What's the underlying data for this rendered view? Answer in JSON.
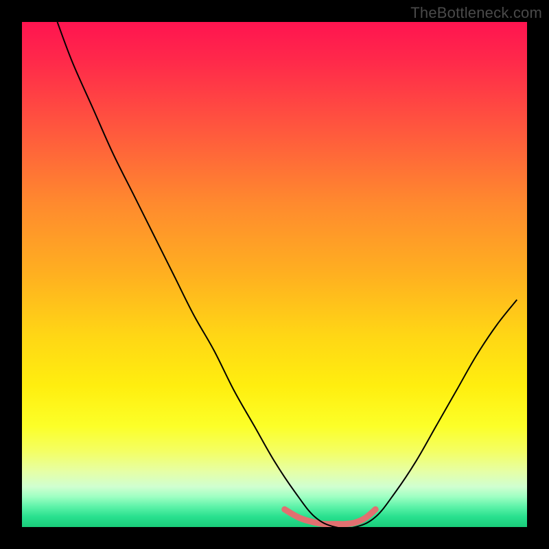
{
  "watermark": "TheBottleneck.com",
  "chart_data": {
    "type": "line",
    "title": "",
    "xlabel": "",
    "ylabel": "",
    "xlim": [
      0,
      100
    ],
    "ylim": [
      0,
      100
    ],
    "grid": false,
    "gradient_stops": [
      {
        "pos": 0,
        "color": "#ff1450"
      },
      {
        "pos": 8,
        "color": "#ff2a4a"
      },
      {
        "pos": 22,
        "color": "#ff5a3d"
      },
      {
        "pos": 36,
        "color": "#ff8a2e"
      },
      {
        "pos": 50,
        "color": "#ffb020"
      },
      {
        "pos": 62,
        "color": "#ffd615"
      },
      {
        "pos": 72,
        "color": "#ffee0f"
      },
      {
        "pos": 80,
        "color": "#fcff28"
      },
      {
        "pos": 85,
        "color": "#f4ff63"
      },
      {
        "pos": 89,
        "color": "#e6ffa6"
      },
      {
        "pos": 92,
        "color": "#d0ffd0"
      },
      {
        "pos": 94,
        "color": "#9effc3"
      },
      {
        "pos": 96,
        "color": "#5cf2a8"
      },
      {
        "pos": 98,
        "color": "#28e08e"
      },
      {
        "pos": 100,
        "color": "#1acc7a"
      }
    ],
    "series": [
      {
        "name": "curve",
        "color": "#000000",
        "width": 2,
        "x": [
          7,
          10,
          14,
          18,
          22,
          26,
          30,
          34,
          38,
          42,
          46,
          50,
          54,
          58,
          62,
          66,
          70,
          74,
          78,
          82,
          86,
          90,
          94,
          98
        ],
        "y": [
          100,
          92,
          83,
          74,
          66,
          58,
          50,
          42,
          35,
          27,
          20,
          13,
          7,
          2,
          0,
          0,
          2,
          7,
          13,
          20,
          27,
          34,
          40,
          45
        ]
      },
      {
        "name": "bottom-highlight",
        "color": "#e17070",
        "width": 9,
        "cap": "round",
        "x": [
          52,
          55,
          58,
          60,
          62,
          64,
          66,
          68,
          70
        ],
        "y": [
          3.5,
          1.8,
          0.9,
          0.6,
          0.6,
          0.6,
          0.9,
          1.8,
          3.5
        ]
      }
    ]
  }
}
